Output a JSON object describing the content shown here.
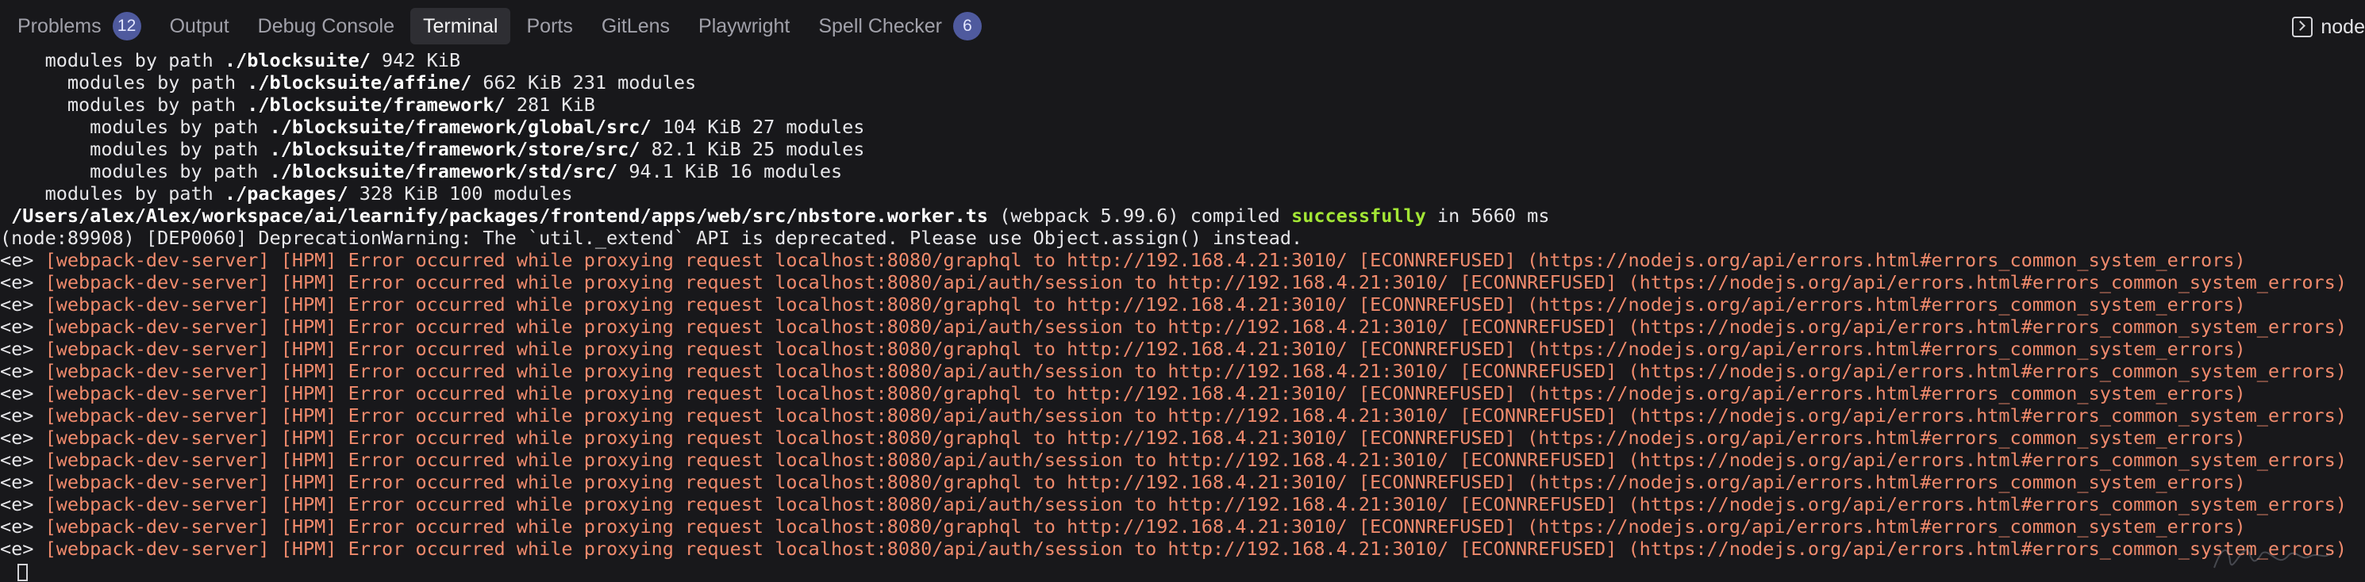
{
  "tabs": [
    {
      "label": "Problems",
      "badge": "12"
    },
    {
      "label": "Output"
    },
    {
      "label": "Debug Console"
    },
    {
      "label": "Terminal",
      "active": true
    },
    {
      "label": "Ports"
    },
    {
      "label": "GitLens"
    },
    {
      "label": "Playwright"
    },
    {
      "label": "Spell Checker",
      "badge": "6"
    }
  ],
  "terminal_kind": {
    "label": "node",
    "icon": "terminal-icon"
  },
  "colors": {
    "background": "#18181b",
    "error": "#f08a6c",
    "success": "#a3e635",
    "badge": "#4f5a9e"
  },
  "terminal": {
    "modules": [
      {
        "text": "    modules by path ",
        "path": "./blocksuite/",
        "info": " 942 KiB"
      },
      {
        "text": "      modules by path ",
        "path": "./blocksuite/affine/",
        "info": " 662 KiB 231 modules"
      },
      {
        "text": "      modules by path ",
        "path": "./blocksuite/framework/",
        "info": " 281 KiB"
      },
      {
        "text": "        modules by path ",
        "path": "./blocksuite/framework/global/src/",
        "info": " 104 KiB 27 modules"
      },
      {
        "text": "        modules by path ",
        "path": "./blocksuite/framework/store/src/",
        "info": " 82.1 KiB 25 modules"
      },
      {
        "text": "        modules by path ",
        "path": "./blocksuite/framework/std/src/",
        "info": " 94.1 KiB 16 modules"
      },
      {
        "text": "    modules by path ",
        "path": "./packages/",
        "info": " 328 KiB 100 modules"
      }
    ],
    "compile": {
      "file": " /Users/alex/Alex/workspace/ai/learnify/packages/frontend/apps/web/src/nbstore.worker.ts",
      "mid": " (webpack 5.99.6) compiled ",
      "status": "successfully",
      "tail": " in 5660 ms"
    },
    "deprecation": "(node:89908) [DEP0060] DeprecationWarning: The `util._extend` API is deprecated. Please use Object.assign() instead.",
    "error_prefix": "<e> ",
    "errors": [
      "[webpack-dev-server] [HPM] Error occurred while proxying request localhost:8080/graphql to http://192.168.4.21:3010/ [ECONNREFUSED] (https://nodejs.org/api/errors.html#errors_common_system_errors)",
      "[webpack-dev-server] [HPM] Error occurred while proxying request localhost:8080/api/auth/session to http://192.168.4.21:3010/ [ECONNREFUSED] (https://nodejs.org/api/errors.html#errors_common_system_errors)",
      "[webpack-dev-server] [HPM] Error occurred while proxying request localhost:8080/graphql to http://192.168.4.21:3010/ [ECONNREFUSED] (https://nodejs.org/api/errors.html#errors_common_system_errors)",
      "[webpack-dev-server] [HPM] Error occurred while proxying request localhost:8080/api/auth/session to http://192.168.4.21:3010/ [ECONNREFUSED] (https://nodejs.org/api/errors.html#errors_common_system_errors)",
      "[webpack-dev-server] [HPM] Error occurred while proxying request localhost:8080/graphql to http://192.168.4.21:3010/ [ECONNREFUSED] (https://nodejs.org/api/errors.html#errors_common_system_errors)",
      "[webpack-dev-server] [HPM] Error occurred while proxying request localhost:8080/api/auth/session to http://192.168.4.21:3010/ [ECONNREFUSED] (https://nodejs.org/api/errors.html#errors_common_system_errors)",
      "[webpack-dev-server] [HPM] Error occurred while proxying request localhost:8080/graphql to http://192.168.4.21:3010/ [ECONNREFUSED] (https://nodejs.org/api/errors.html#errors_common_system_errors)",
      "[webpack-dev-server] [HPM] Error occurred while proxying request localhost:8080/api/auth/session to http://192.168.4.21:3010/ [ECONNREFUSED] (https://nodejs.org/api/errors.html#errors_common_system_errors)",
      "[webpack-dev-server] [HPM] Error occurred while proxying request localhost:8080/graphql to http://192.168.4.21:3010/ [ECONNREFUSED] (https://nodejs.org/api/errors.html#errors_common_system_errors)",
      "[webpack-dev-server] [HPM] Error occurred while proxying request localhost:8080/api/auth/session to http://192.168.4.21:3010/ [ECONNREFUSED] (https://nodejs.org/api/errors.html#errors_common_system_errors)",
      "[webpack-dev-server] [HPM] Error occurred while proxying request localhost:8080/graphql to http://192.168.4.21:3010/ [ECONNREFUSED] (https://nodejs.org/api/errors.html#errors_common_system_errors)",
      "[webpack-dev-server] [HPM] Error occurred while proxying request localhost:8080/api/auth/session to http://192.168.4.21:3010/ [ECONNREFUSED] (https://nodejs.org/api/errors.html#errors_common_system_errors)",
      "[webpack-dev-server] [HPM] Error occurred while proxying request localhost:8080/graphql to http://192.168.4.21:3010/ [ECONNREFUSED] (https://nodejs.org/api/errors.html#errors_common_system_errors)",
      "[webpack-dev-server] [HPM] Error occurred while proxying request localhost:8080/api/auth/session to http://192.168.4.21:3010/ [ECONNREFUSED] (https://nodejs.org/api/errors.html#errors_common_system_errors)"
    ]
  }
}
